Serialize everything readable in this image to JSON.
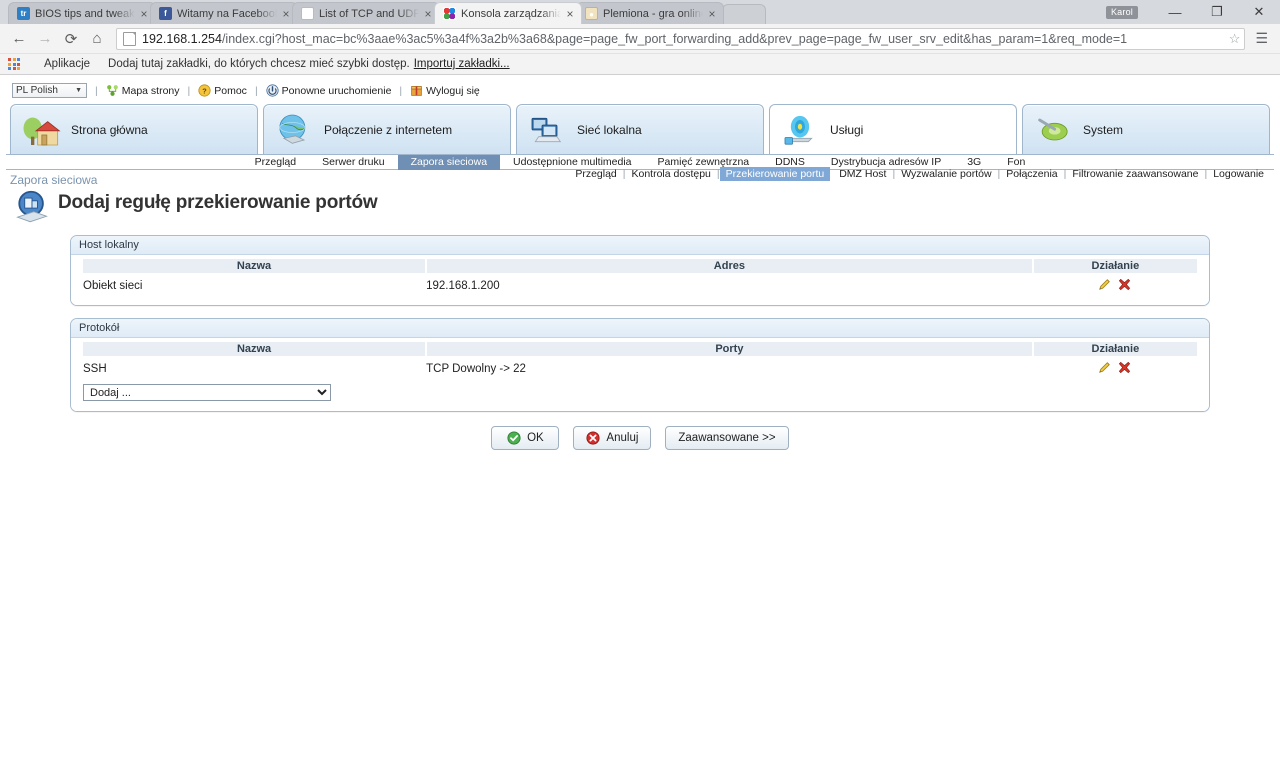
{
  "browser": {
    "tabs": [
      {
        "title": "BIOS tips and tweaks for",
        "favicon": "tripadvisor-icon",
        "active": false,
        "close_label": "×"
      },
      {
        "title": "Witamy na Facebooku. Za",
        "favicon": "facebook-icon",
        "active": false,
        "close_label": "×"
      },
      {
        "title": "List of TCP and UDP port",
        "favicon": "wikipedia-icon",
        "active": false,
        "close_label": "×"
      },
      {
        "title": "Konsola zarządzania NETI",
        "favicon": "netia-icon",
        "active": true,
        "close_label": "×"
      },
      {
        "title": "Plemiona - gra online",
        "favicon": "plemiona-icon",
        "active": false,
        "close_label": "×"
      }
    ],
    "user_badge": "Karol",
    "window_buttons": {
      "minimize": "—",
      "maximize": "❐",
      "close": "✕"
    },
    "nav": {
      "back": "←",
      "forward": "→",
      "reload": "⟳",
      "home": "⌂"
    },
    "url_host": "192.168.1.254",
    "url_rest": "/index.cgi?host_mac=bc%3aae%3ac5%3a4f%3a2b%3a68&page=page_fw_port_forwarding_add&prev_page=page_fw_user_srv_edit&has_param=1&req_mode=1",
    "star": "☆",
    "menu": "☰",
    "bookmarks": {
      "apps_label": "Aplikacje",
      "hint": "Dodaj tutaj zakładki, do których chcesz mieć szybki dostęp.",
      "import_link": "Importuj zakładki..."
    }
  },
  "router": {
    "language": "PL Polish",
    "top_links": [
      {
        "label": "Mapa strony",
        "icon": "sitemap-icon"
      },
      {
        "label": "Pomoc",
        "icon": "help-icon"
      },
      {
        "label": "Ponowne uruchomienie",
        "icon": "restart-icon"
      },
      {
        "label": "Wyloguj się",
        "icon": "logout-icon"
      }
    ],
    "main_tabs": [
      {
        "label": "Strona główna",
        "icon": "home-icon",
        "active": false
      },
      {
        "label": "Połączenie z internetem",
        "icon": "globe-icon",
        "active": false
      },
      {
        "label": "Sieć lokalna",
        "icon": "computers-icon",
        "active": false
      },
      {
        "label": "Usługi",
        "icon": "services-icon",
        "active": true
      },
      {
        "label": "System",
        "icon": "system-icon",
        "active": false
      }
    ],
    "sub_nav": [
      {
        "label": "Przegląd",
        "active": false
      },
      {
        "label": "Serwer druku",
        "active": false
      },
      {
        "label": "Zapora sieciowa",
        "active": true
      },
      {
        "label": "Udostępnione multimedia",
        "active": false
      },
      {
        "label": "Pamięć zewnętrzna",
        "active": false
      },
      {
        "label": "DDNS",
        "active": false
      },
      {
        "label": "Dystrybucja adresów IP",
        "active": false
      },
      {
        "label": "3G",
        "active": false
      },
      {
        "label": "Fon",
        "active": false
      }
    ],
    "breadcrumb": "Zapora sieciowa",
    "page_title": "Dodaj regułę przekierowanie portów",
    "page_icon": "firewall-icon",
    "right_nav": [
      {
        "label": "Przegląd",
        "active": false
      },
      {
        "label": "Kontrola dostępu",
        "active": false
      },
      {
        "label": "Przekierowanie portu",
        "active": true
      },
      {
        "label": "DMZ Host",
        "active": false
      },
      {
        "label": "Wyzwalanie portów",
        "active": false
      },
      {
        "label": "Połączenia",
        "active": false
      },
      {
        "label": "Filtrowanie zaawansowane",
        "active": false
      },
      {
        "label": "Logowanie",
        "active": false
      }
    ],
    "panels": [
      {
        "heading": "Host lokalny",
        "columns": [
          "Nazwa",
          "Adres",
          "Działanie"
        ],
        "rows": [
          {
            "name": "Obiekt sieci",
            "value": "192.168.1.200",
            "edit_icon": "edit-pencil-icon",
            "delete_icon": "delete-x-icon"
          }
        ],
        "has_select": false
      },
      {
        "heading": "Protokół",
        "columns": [
          "Nazwa",
          "Porty",
          "Działanie"
        ],
        "rows": [
          {
            "name": "SSH",
            "value": "TCP Dowolny -> 22",
            "edit_icon": "edit-pencil-icon",
            "delete_icon": "delete-x-icon"
          }
        ],
        "has_select": true,
        "select_value": "Dodaj ...",
        "select_options": [
          "Dodaj ..."
        ]
      }
    ],
    "buttons": [
      {
        "label": "OK",
        "icon": "ok-check-icon"
      },
      {
        "label": "Anuluj",
        "icon": "cancel-x-icon"
      },
      {
        "label": "Zaawansowane >>",
        "icon": "none"
      }
    ],
    "colors": {
      "accent": "#7fa8d6",
      "panel_border": "#a9bdd1",
      "subnav_active": "#6f8fb5",
      "breadcrumb": "#7a93ad"
    }
  }
}
